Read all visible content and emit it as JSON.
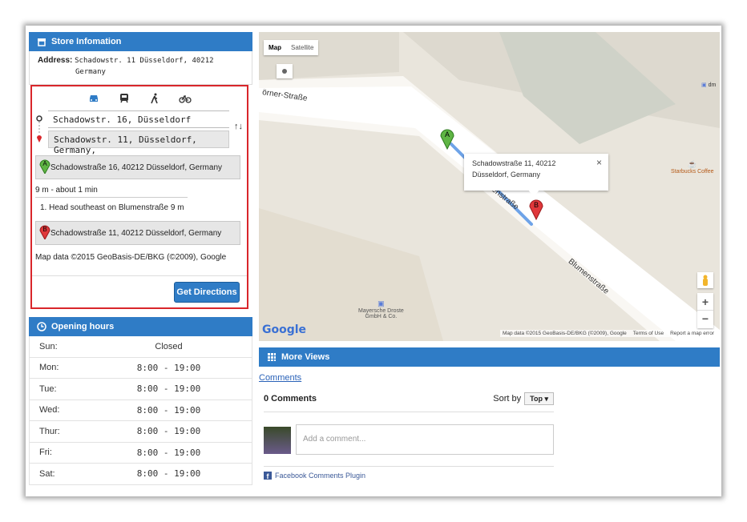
{
  "store": {
    "title": "Store Infomation",
    "address_label": "Address:",
    "address_line1": "Schadowstr. 11 Düsseldorf, 40212",
    "address_line2": "Germany"
  },
  "directions": {
    "modes": [
      "car-icon",
      "transit-icon",
      "walk-icon",
      "bike-icon"
    ],
    "from_value": "Schadowstr. 16, Düsseldorf",
    "to_value": "Schadowstr. 11, Düsseldorf, Germany,",
    "swap_label": "↑↓",
    "start_address": "Schadowstraße 16, 40212 Düsseldorf, Germany",
    "summary": "9 m - about 1 min",
    "step": "1.  Head southeast on Blumenstraße  9 m",
    "end_address": "Schadowstraße 11, 40212 Düsseldorf, Germany",
    "copyright": "Map data ©2015 GeoBasis-DE/BKG (©2009), Google",
    "button": "Get Directions",
    "pin_a": "A",
    "pin_b": "B"
  },
  "hours": {
    "title": "Opening hours",
    "rows": [
      {
        "day": "Sun:",
        "time": "Closed"
      },
      {
        "day": "Mon:",
        "time": "8:00 - 19:00"
      },
      {
        "day": "Tue:",
        "time": "8:00 - 19:00"
      },
      {
        "day": "Wed:",
        "time": "8:00 - 19:00"
      },
      {
        "day": "Thur:",
        "time": "8:00 - 19:00"
      },
      {
        "day": "Fri:",
        "time": "8:00 - 19:00"
      },
      {
        "day": "Sat:",
        "time": "8:00 - 19:00"
      }
    ]
  },
  "map": {
    "tab_map": "Map",
    "tab_satellite": "Satellite",
    "street1": "örner-Straße",
    "street2": "Blumenstraße",
    "street3": "menstraße",
    "info_line1": "Schadowstraße 11, 40212",
    "info_line2": "Düsseldorf, Germany",
    "info_close": "×",
    "poi1_line1": "Mayersche Droste",
    "poi1_line2": "GmbH & Co.",
    "poi2": "Starbucks Coffee",
    "poi3": "dm",
    "google": "Google",
    "footer_data": "Map data ©2015 GeoBasis-DE/BKG (©2009), Google",
    "footer_terms": "Terms of Use",
    "footer_report": "Report a map error",
    "zoom_in": "+",
    "zoom_out": "−",
    "pin_a": "A",
    "pin_b": "B"
  },
  "views": {
    "title": "More Views",
    "comments_link": "Comments",
    "count": "0 Comments",
    "sort_label": "Sort by",
    "sort_value": "Top ▾",
    "placeholder": "Add a comment...",
    "plugin": "Facebook Comments Plugin"
  },
  "colors": {
    "accent": "#2f7cc6",
    "highlight": "#d9262b"
  }
}
